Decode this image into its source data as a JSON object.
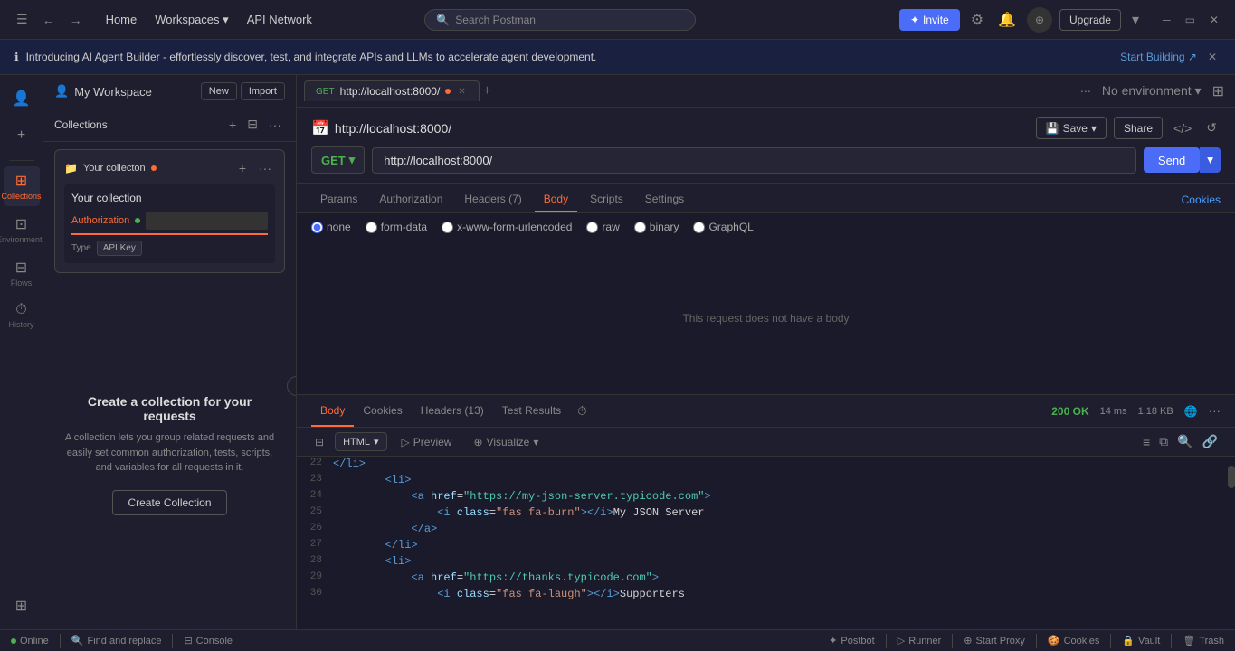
{
  "titlebar": {
    "home": "Home",
    "workspaces": "Workspaces",
    "api_network": "API Network",
    "search_placeholder": "Search Postman",
    "invite_label": "Invite",
    "upgrade_label": "Upgrade"
  },
  "banner": {
    "text": "Introducing AI Agent Builder - effortlessly discover, test, and integrate APIs and LLMs to accelerate agent development.",
    "cta": "Start Building ↗"
  },
  "sidebar": {
    "workspace_name": "My Workspace",
    "new_btn": "New",
    "import_btn": "Import",
    "tabs": [
      {
        "id": "collections",
        "label": "Collections",
        "icon": "⊞"
      },
      {
        "id": "environments",
        "label": "Environments",
        "icon": "⊡"
      },
      {
        "id": "flows",
        "label": "Flows",
        "icon": "⊟"
      },
      {
        "id": "history",
        "label": "History",
        "icon": "⏱"
      },
      {
        "id": "more",
        "label": "",
        "icon": "⊞"
      }
    ]
  },
  "collection_card": {
    "title": "Your collecton",
    "body_title": "Your collection",
    "tab_label": "Authorization",
    "type_label": "Type",
    "type_value": "API Key"
  },
  "create_section": {
    "title": "Create a collection for your requests",
    "description": "A collection lets you group related requests and easily set common authorization, tests, scripts, and variables for all requests in it.",
    "button": "Create Collection"
  },
  "request_tab": {
    "method": "GET",
    "url_display": "http://localhost:8000/",
    "url_full": "http://localhost:8000/",
    "dot_color": "#ff6b35"
  },
  "request_url_header": {
    "url": "http://localhost:8000/",
    "save_label": "Save",
    "share_label": "Share"
  },
  "request_tabs": {
    "items": [
      {
        "label": "Params",
        "active": false
      },
      {
        "label": "Authorization",
        "active": false
      },
      {
        "label": "Headers (7)",
        "active": false
      },
      {
        "label": "Body",
        "active": true
      },
      {
        "label": "Scripts",
        "active": false
      },
      {
        "label": "Settings",
        "active": false
      }
    ],
    "right": "Cookies"
  },
  "body_options": [
    {
      "id": "none",
      "label": "none",
      "checked": true
    },
    {
      "id": "form-data",
      "label": "form-data",
      "checked": false
    },
    {
      "id": "urlencoded",
      "label": "x-www-form-urlencoded",
      "checked": false
    },
    {
      "id": "raw",
      "label": "raw",
      "checked": false
    },
    {
      "id": "binary",
      "label": "binary",
      "checked": false
    },
    {
      "id": "graphql",
      "label": "GraphQL",
      "checked": false
    }
  ],
  "no_body_message": "This request does not have a body",
  "response": {
    "tabs": [
      "Body",
      "Cookies",
      "Headers (13)",
      "Test Results"
    ],
    "active_tab": "Body",
    "status": "200 OK",
    "time": "14 ms",
    "size": "1.18 KB",
    "format": "HTML",
    "toolbar_items": [
      "Preview",
      "Visualize"
    ]
  },
  "code_lines": [
    {
      "num": "22",
      "content": "        </li>",
      "type": "tag"
    },
    {
      "num": "23",
      "content": "        <li>",
      "type": "tag"
    },
    {
      "num": "24",
      "content": "            <a href=\"https://my-json-server.typicode.com\">",
      "type": "link"
    },
    {
      "num": "25",
      "content": "                <i class=\"fas fa-burn\"></i>My JSON Server",
      "type": "mixed"
    },
    {
      "num": "26",
      "content": "            </a>",
      "type": "tag"
    },
    {
      "num": "27",
      "content": "        </li>",
      "type": "tag"
    },
    {
      "num": "28",
      "content": "        <li>",
      "type": "tag"
    },
    {
      "num": "29",
      "content": "            <a href=\"https://thanks.typicode.com\">",
      "type": "link"
    },
    {
      "num": "30",
      "content": "                <i class=\"fas fa-laugh\"></i>Supporters",
      "type": "mixed"
    }
  ],
  "statusbar": {
    "online": "Online",
    "find_replace": "Find and replace",
    "console": "Console",
    "postbot": "Postbot",
    "runner": "Runner",
    "start_proxy": "Start Proxy",
    "cookies": "Cookies",
    "vault": "Vault",
    "trash": "Trash"
  }
}
